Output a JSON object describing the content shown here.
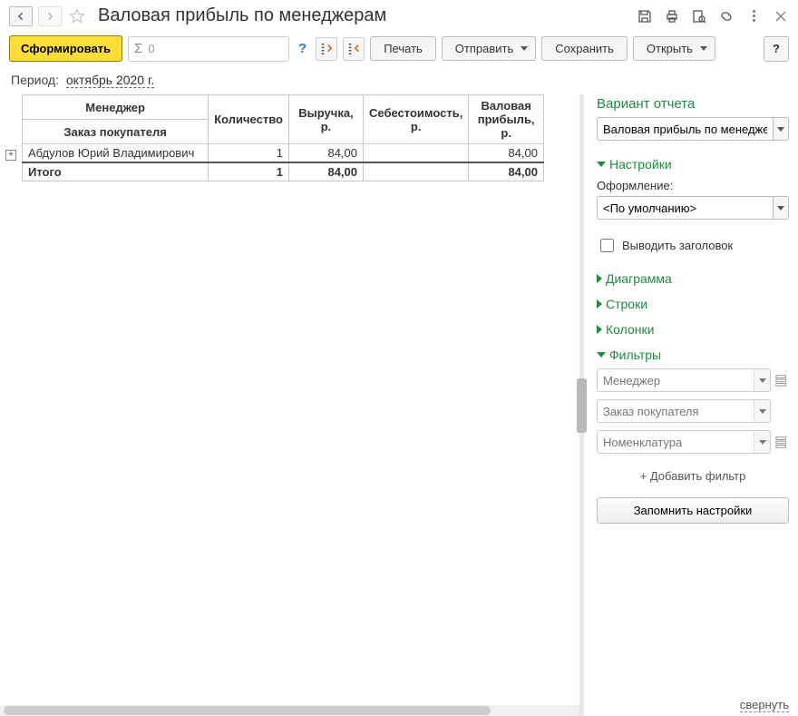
{
  "title": "Валовая прибыль по менеджерам",
  "toolbar": {
    "generate": "Сформировать",
    "sum_value": "0",
    "print": "Печать",
    "send": "Отправить",
    "save": "Сохранить",
    "open": "Открыть"
  },
  "period": {
    "label": "Период:",
    "value": "октябрь 2020 г."
  },
  "table": {
    "headers": {
      "manager": "Менеджер",
      "order": "Заказ покупателя",
      "qty": "Количество",
      "revenue": "Выручка, р.",
      "cost": "Себестоимость, р.",
      "gross": "Валовая прибыль, р."
    },
    "rows": [
      {
        "manager": "Абдулов Юрий Владимирович",
        "qty": "1",
        "revenue": "84,00",
        "cost": "",
        "gross": "84,00"
      }
    ],
    "total": {
      "label": "Итого",
      "qty": "1",
      "revenue": "84,00",
      "cost": "",
      "gross": "84,00"
    }
  },
  "rpanel": {
    "variant_heading": "Вариант отчета",
    "variant_value": "Валовая прибыль по менеджерам",
    "settings": "Настройки",
    "appearance_label": "Оформление:",
    "appearance_value": "<По умолчанию>",
    "show_title": "Выводить заголовок",
    "diagram": "Диаграмма",
    "rows": "Строки",
    "columns": "Колонки",
    "filters": "Фильтры",
    "filter_items": {
      "manager": "Менеджер",
      "order": "Заказ покупателя",
      "nomenclature": "Номенклатура"
    },
    "add_filter": "+ Добавить фильтр",
    "remember": "Запомнить настройки"
  },
  "collapse": "свернуть"
}
